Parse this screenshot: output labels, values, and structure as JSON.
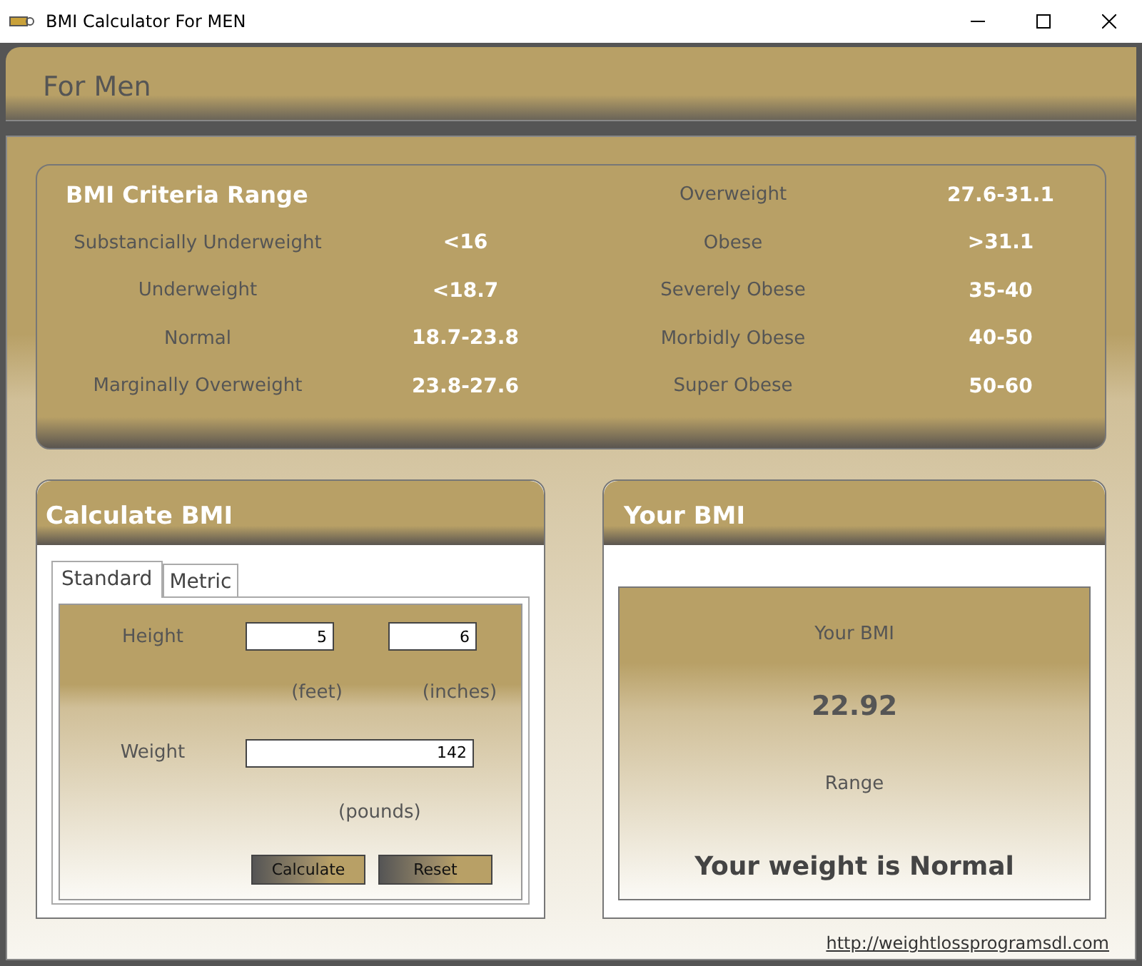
{
  "window": {
    "title": "BMI Calculator For MEN"
  },
  "header": {
    "title": "For Men"
  },
  "criteria": {
    "title": "BMI Criteria Range",
    "left": [
      {
        "label": "Substancially Underweight",
        "value": "<16"
      },
      {
        "label": "Underweight",
        "value": "<18.7"
      },
      {
        "label": "Normal",
        "value": "18.7-23.8"
      },
      {
        "label": "Marginally Overweight",
        "value": "23.8-27.6"
      }
    ],
    "right": [
      {
        "label": "Overweight",
        "value": "27.6-31.1"
      },
      {
        "label": "Obese",
        "value": ">31.1"
      },
      {
        "label": "Severely Obese",
        "value": "35-40"
      },
      {
        "label": "Morbidly Obese",
        "value": "40-50"
      },
      {
        "label": "Super Obese",
        "value": "50-60"
      }
    ]
  },
  "calculator": {
    "title": "Calculate BMI",
    "tabs": [
      {
        "label": "Standard",
        "selected": true
      },
      {
        "label": "Metric",
        "selected": false
      }
    ],
    "height_label": "Height",
    "feet": "5",
    "inches": "6",
    "feet_unit": "(feet)",
    "inches_unit": "(inches)",
    "weight_label": "Weight",
    "weight": "142",
    "weight_unit": "(pounds)",
    "buttons": [
      "Calculate",
      "Reset"
    ]
  },
  "result": {
    "title": "Your BMI",
    "label": "Your BMI",
    "value": "22.92",
    "range_label": "Range",
    "message": "Your weight is Normal"
  },
  "footer": {
    "link": "http://weightlossprogramsdl.com"
  }
}
